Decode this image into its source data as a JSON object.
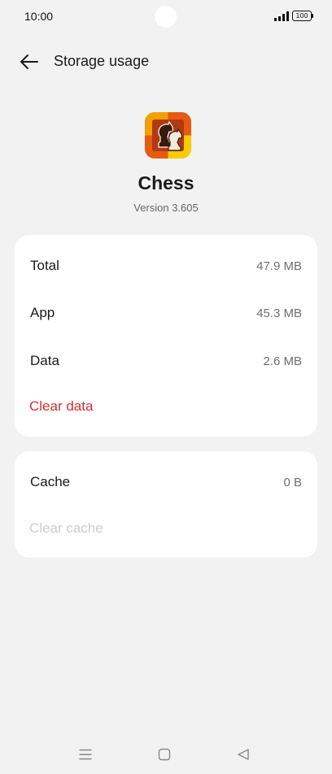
{
  "status_bar": {
    "time": "10:00",
    "battery": "100",
    "icons": [
      "signal-icon",
      "battery-icon"
    ]
  },
  "header": {
    "title": "Storage usage",
    "back_icon": "arrow-left-icon"
  },
  "app": {
    "name": "Chess",
    "version": "Version 3.605",
    "icon": "chess-app-icon"
  },
  "storage": {
    "rows": [
      {
        "label": "Total",
        "value": "47.9 MB"
      },
      {
        "label": "App",
        "value": "45.3 MB"
      },
      {
        "label": "Data",
        "value": "2.6 MB"
      }
    ],
    "clear_data_label": "Clear data"
  },
  "cache": {
    "label": "Cache",
    "value": "0 B",
    "clear_cache_label": "Clear cache"
  },
  "nav": {
    "icons": [
      "menu-icon",
      "home-icon",
      "back-triangle-icon"
    ]
  },
  "colors": {
    "background": "#f2f2f2",
    "card": "#ffffff",
    "accent_red": "#d32f2f",
    "disabled_text": "#cdcdcd"
  }
}
